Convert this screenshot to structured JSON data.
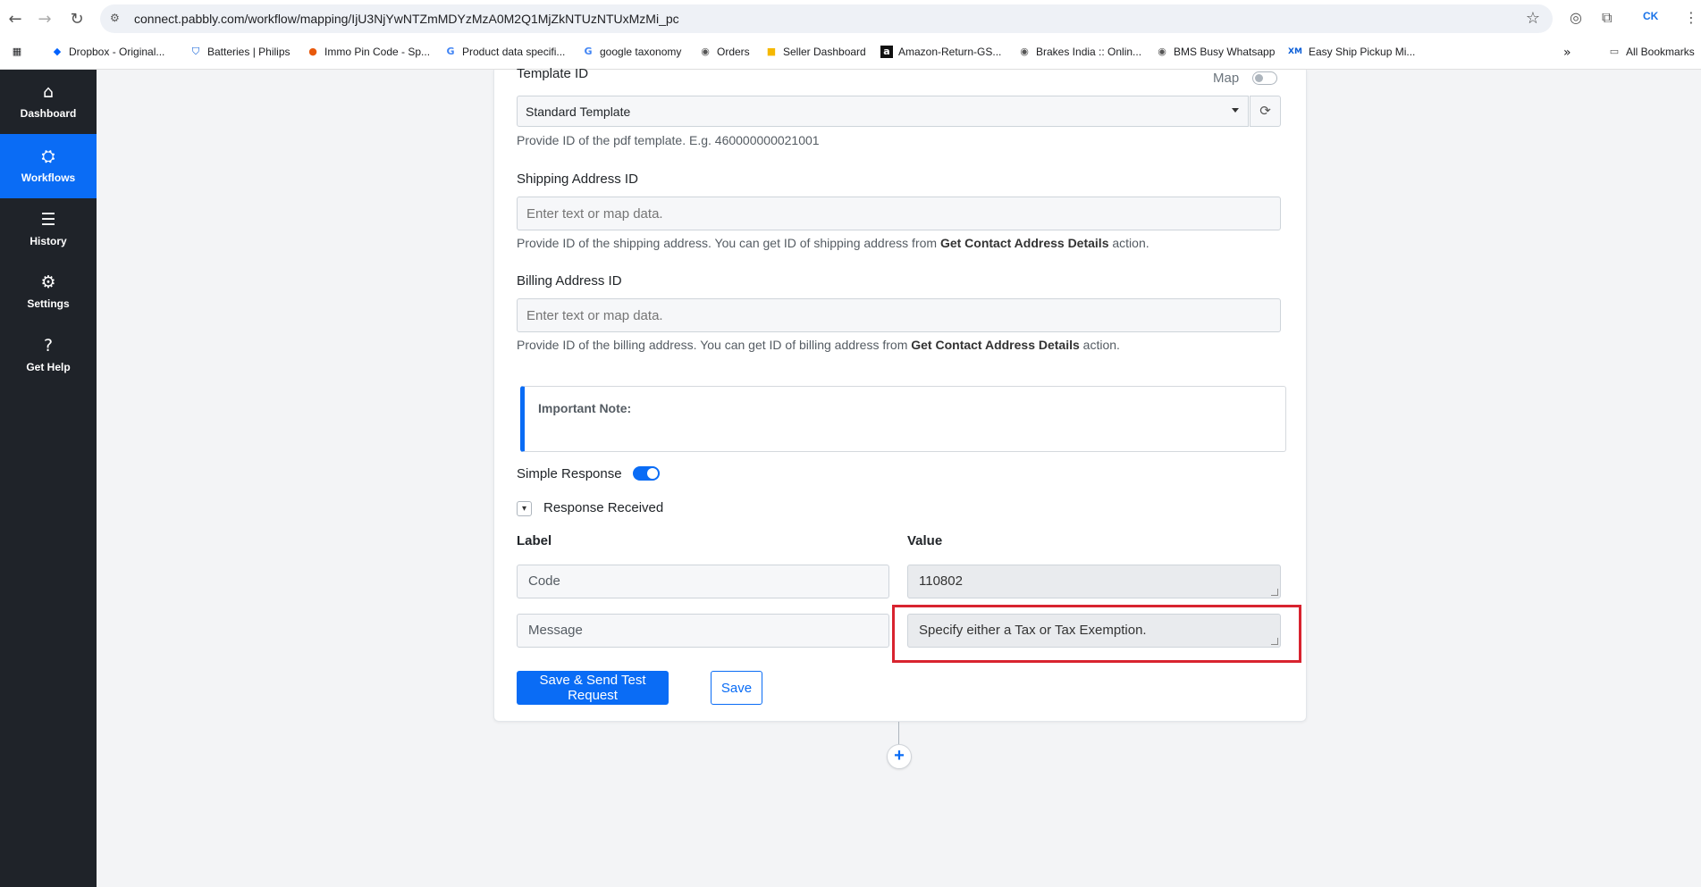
{
  "browser": {
    "url": "connect.pabbly.com/workflow/mapping/IjU3NjYwNTZmMDYzMzA0M2Q1MjZkNTUzNTUxMzMi_pc",
    "profile": "CK",
    "bookmarks": [
      {
        "label": "Dropbox - Original...",
        "icon": "dropbox-icon"
      },
      {
        "label": "Batteries | Philips",
        "icon": "shield-icon"
      },
      {
        "label": "Immo Pin Code - Sp...",
        "icon": "pin-icon"
      },
      {
        "label": "Product data specifi...",
        "icon": "google-icon"
      },
      {
        "label": "google taxonomy",
        "icon": "google-icon"
      },
      {
        "label": "Orders",
        "icon": "globe-icon"
      },
      {
        "label": "Seller Dashboard",
        "icon": "folder-icon"
      },
      {
        "label": "Amazon-Return-GS...",
        "icon": "amazon-icon"
      },
      {
        "label": "Brakes India :: Onlin...",
        "icon": "globe-icon"
      },
      {
        "label": "BMS Busy Whatsapp",
        "icon": "globe-icon"
      },
      {
        "label": "Easy Ship Pickup Mi...",
        "icon": "xm-icon"
      }
    ],
    "all_bookmarks": "All Bookmarks"
  },
  "sidebar": {
    "items": [
      {
        "label": "Dashboard",
        "icon": "home-icon"
      },
      {
        "label": "Workflows",
        "icon": "workflow-icon"
      },
      {
        "label": "History",
        "icon": "list-icon"
      },
      {
        "label": "Settings",
        "icon": "gear-icon"
      },
      {
        "label": "Get Help",
        "icon": "help-icon"
      }
    ],
    "active": "Workflows"
  },
  "form": {
    "template": {
      "label": "Template ID",
      "map_label": "Map",
      "selected": "Standard Template",
      "help": "Provide ID of the pdf template. E.g. 460000000021001"
    },
    "shipping": {
      "label": "Shipping Address ID",
      "placeholder": "Enter text or map data.",
      "help_prefix": "Provide ID of the shipping address. You can get ID of shipping address from ",
      "help_bold": "Get Contact Address Details",
      "help_suffix": " action."
    },
    "billing": {
      "label": "Billing Address ID",
      "placeholder": "Enter text or map data.",
      "help_prefix": "Provide ID of the billing address. You can get ID of billing address from ",
      "help_bold": "Get Contact Address Details",
      "help_suffix": " action."
    },
    "note_title": "Important Note:",
    "simple_response": "Simple Response",
    "response_received": "Response Received",
    "columns": {
      "label": "Label",
      "value": "Value"
    },
    "rows": [
      {
        "label": "Code",
        "value": "110802"
      },
      {
        "label": "Message",
        "value": "Specify either a Tax or Tax Exemption."
      }
    ],
    "save_send_label": "Save & Send Test Request",
    "save_label": "Save"
  },
  "colors": {
    "accent": "#0a6cf5",
    "sidebar_bg": "#1f2329",
    "highlight": "#d8232f"
  }
}
